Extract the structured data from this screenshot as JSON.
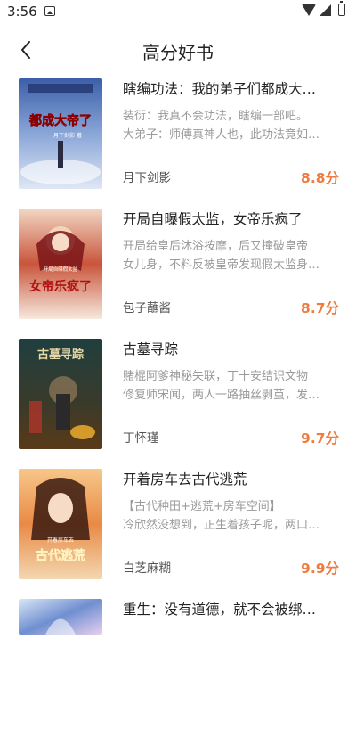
{
  "status": {
    "time": "3:56"
  },
  "header": {
    "title": "高分好书"
  },
  "books": [
    {
      "title": "瞎编功法：我的弟子们都成大…",
      "desc1": "装衍：我真不会功法，瞎编一部吧。",
      "desc2": "大弟子：师傅真神人也，此功法竟如…",
      "author": "月下剑影",
      "score": "8.8分",
      "cover_text": "都成大帝了",
      "cover_sub": "月下剑影 著"
    },
    {
      "title": "开局自曝假太监，女帝乐疯了",
      "desc1": "开局给皇后沐浴按摩，后又撞破皇帝",
      "desc2": "女儿身，不料反被皇帝发现假太监身…",
      "author": "包子蘸酱",
      "score": "8.7分",
      "cover_text": "女帝乐疯了",
      "cover_sub": "开局自曝假太监"
    },
    {
      "title": "古墓寻踪",
      "desc1": "赌棍阿爹神秘失联，丁十安结识文物",
      "desc2": "修复师宋闻，两人一路抽丝剥茧，发…",
      "author": "丁怀瑾",
      "score": "9.7分",
      "cover_text": "古墓寻踪",
      "cover_sub": ""
    },
    {
      "title": "开着房车去古代逃荒",
      "desc1": "【古代种田+逃荒+房车空间】",
      "desc2": "冷欣然没想到，正生着孩子呢，两口…",
      "author": "白芝麻糊",
      "score": "9.9分",
      "cover_text": "古代逃荒",
      "cover_sub": "开着房车去"
    },
    {
      "title": "重生：没有道德，就不会被绑…",
      "desc1": "",
      "desc2": "",
      "author": "",
      "score": "",
      "cover_text": "",
      "cover_sub": ""
    }
  ],
  "colors": {
    "score": "#f07b3f",
    "title": "#222222",
    "desc": "#9a9a9a"
  }
}
